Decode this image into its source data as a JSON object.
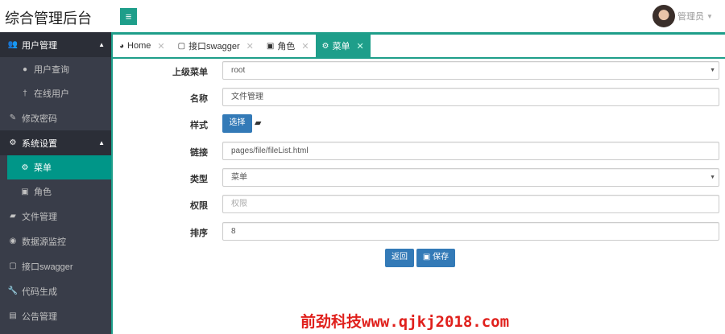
{
  "header": {
    "title": "综合管理后台",
    "menu_icon": "hamburger-icon",
    "user_name": "管理员"
  },
  "sidebar": {
    "items": [
      {
        "label": "用户管理",
        "icon": "users-icon"
      },
      {
        "label": "用户查询",
        "icon": "user-icon"
      },
      {
        "label": "在线用户",
        "icon": "male-icon"
      },
      {
        "label": "修改密码",
        "icon": "edit-icon"
      },
      {
        "label": "系统设置",
        "icon": "cogs-icon"
      },
      {
        "label": "菜单",
        "icon": "gear-icon"
      },
      {
        "label": "角色",
        "icon": "lock-icon"
      },
      {
        "label": "文件管理",
        "icon": "folder-open-icon"
      },
      {
        "label": "数据源监控",
        "icon": "eye-icon"
      },
      {
        "label": "接口swagger",
        "icon": "file-pdf-icon"
      },
      {
        "label": "代码生成",
        "icon": "wrench-icon"
      },
      {
        "label": "公告管理",
        "icon": "book-icon"
      }
    ]
  },
  "tabs": [
    {
      "label": "Home"
    },
    {
      "label": "接口swagger"
    },
    {
      "label": "角色"
    },
    {
      "label": "菜单",
      "active": true
    }
  ],
  "form": {
    "parent": {
      "label": "上级菜单",
      "value": "root"
    },
    "name": {
      "label": "名称",
      "value": "文件管理"
    },
    "style": {
      "label": "样式",
      "button": "选择"
    },
    "link": {
      "label": "链接",
      "value": "pages/file/fileList.html"
    },
    "type": {
      "label": "类型",
      "value": "菜单"
    },
    "perm": {
      "label": "权限",
      "placeholder": "权限"
    },
    "sort": {
      "label": "排序",
      "value": "8"
    },
    "back": "返回",
    "save": "保存"
  },
  "watermark": "前劲科技www.qjkj2018.com",
  "colors": {
    "accent": "#1e9e8a",
    "sidebar": "#393d49",
    "primary": "#337ab7"
  }
}
